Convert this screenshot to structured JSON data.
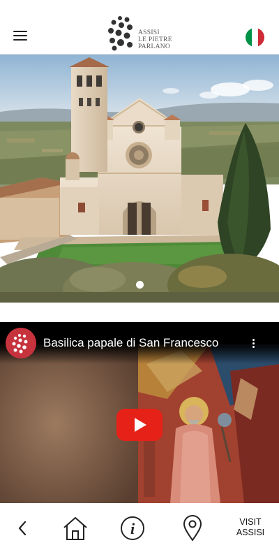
{
  "header": {
    "logo_lines": [
      "ASSISI",
      "LE PIETRE",
      "PARLANO"
    ],
    "language_flag": "italian-flag-icon",
    "menu_icon": "hamburger-menu-icon"
  },
  "hero": {
    "image": "basilica-san-francesco-photo",
    "slides_total": 1,
    "active_slide": 1
  },
  "video": {
    "title": "Basilica papale di San Francesco",
    "channel_icon": "channel-avatar-icon",
    "play_icon": "youtube-play-icon",
    "more_icon": "more-vertical-icon"
  },
  "bottom_nav": {
    "back_icon": "back-chevron-icon",
    "home_icon": "home-icon",
    "info_icon": "info-icon",
    "location_icon": "location-pin-icon",
    "visit_label_line1": "VISIT",
    "visit_label_line2": "ASSISI"
  },
  "colors": {
    "play_button": "#e62117",
    "channel_avatar": "#c7333d",
    "flag_green": "#009246",
    "flag_white": "#ffffff",
    "flag_red": "#ce2b37"
  }
}
